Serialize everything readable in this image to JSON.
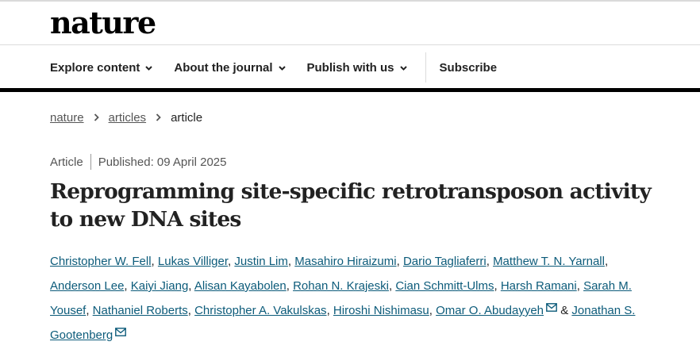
{
  "header": {
    "logo": "nature"
  },
  "nav": {
    "items": [
      {
        "label": "Explore content",
        "icon": "chevron-down-icon"
      },
      {
        "label": "About the journal",
        "icon": "chevron-down-icon"
      },
      {
        "label": "Publish with us",
        "icon": "chevron-down-icon"
      }
    ],
    "subscribe": "Subscribe"
  },
  "breadcrumb": {
    "items": [
      "nature",
      "articles"
    ],
    "current": "article",
    "separator_icon": "chevron-right-icon"
  },
  "article": {
    "type": "Article",
    "published": "Published: 09 April 2025",
    "title": "Reprogramming site-specific retrotransposon activity to new DNA sites",
    "authors": [
      "Christopher W. Fell",
      "Lukas Villiger",
      "Justin Lim",
      "Masahiro Hiraizumi",
      "Dario Tagliaferri",
      "Matthew T. N. Yarnall",
      "Anderson Lee",
      "Kaiyi Jiang",
      "Alisan Kayabolen",
      "Rohan N. Krajeski",
      "Cian Schmitt-Ulms",
      "Harsh Ramani",
      "Sarah M. Yousef",
      "Nathaniel Roberts",
      "Christopher A. Vakulskas",
      "Hiroshi Nishimasu",
      "Omar O. Abudayyeh",
      "Jonathan S. Gootenberg"
    ],
    "corresponding": [
      "Omar O. Abudayyeh",
      "Jonathan S. Gootenberg"
    ],
    "author_separator": ", ",
    "last_conjunction": "&",
    "mail_icon": "mail-icon"
  },
  "colors": {
    "link": "#0c5b7a",
    "nav_band": "#000000",
    "text": "#222222",
    "muted": "#555555"
  }
}
